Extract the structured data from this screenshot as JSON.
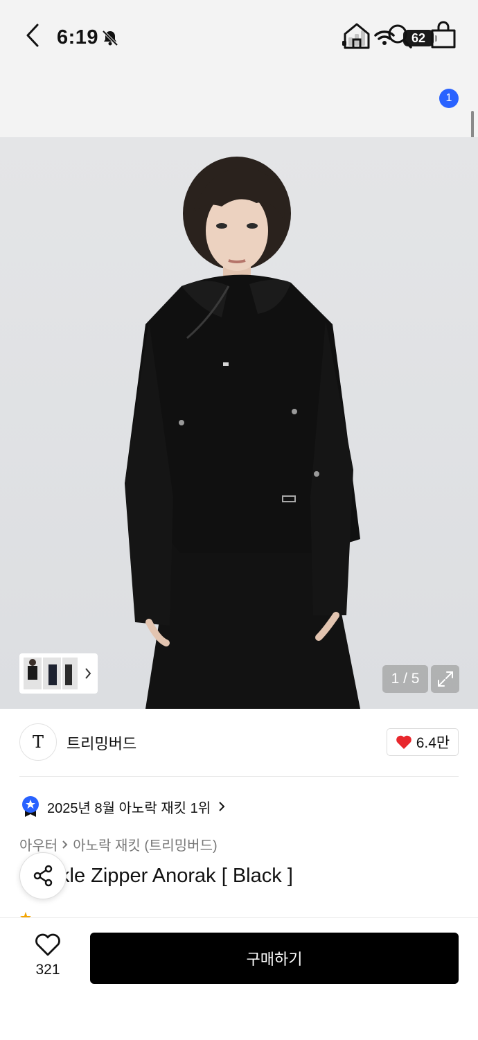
{
  "status_bar": {
    "time": "6:19",
    "battery": "62"
  },
  "nav": {
    "cart_badge": "1"
  },
  "gallery": {
    "counter": "1 / 5"
  },
  "brand": {
    "logo_text": "T",
    "name": "트리밍버드",
    "likes": "6.4만"
  },
  "ranking": {
    "text": "2025년 8월 아노락 재킷 1위"
  },
  "breadcrumb": {
    "category": "아우터",
    "subcategory": "아노락 재킷 (트리밍버드)"
  },
  "product": {
    "title_visible": "kle Zipper Anorak [ Black ]"
  },
  "bottom": {
    "wish_count": "321",
    "buy_label": "구매하기"
  },
  "colors": {
    "badge_blue": "#2962ff",
    "heart_red": "#e8272d",
    "buy_bg": "#000000"
  },
  "icons": [
    "bell-slash-icon",
    "signal-icon",
    "wifi-icon",
    "back-icon",
    "home-icon",
    "search-icon",
    "bag-icon",
    "expand-icon",
    "heart-icon",
    "medal-icon",
    "share-icon"
  ]
}
